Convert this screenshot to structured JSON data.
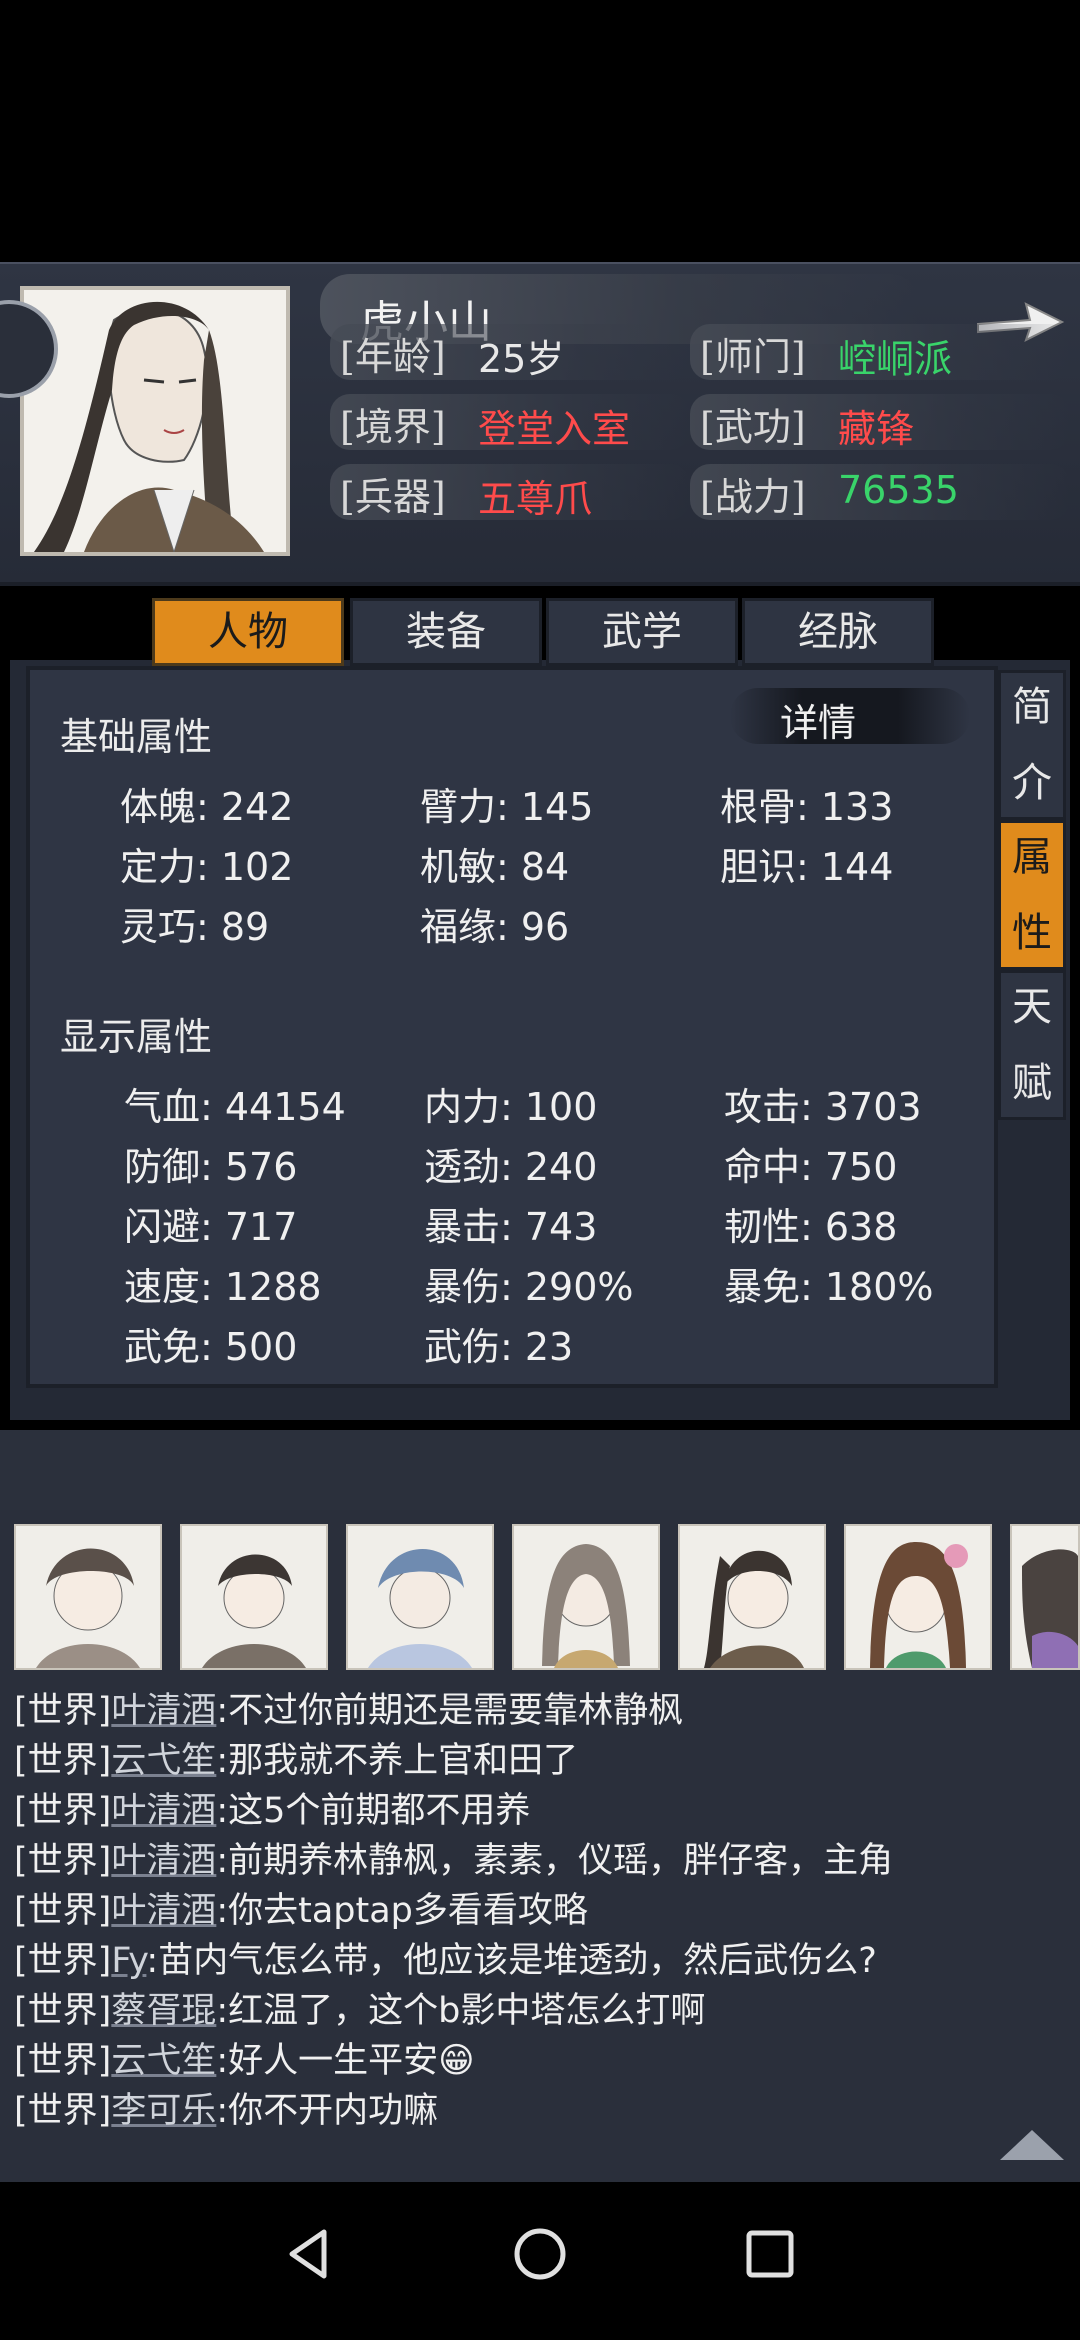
{
  "character": {
    "name": "虎小山",
    "age_label": "[年龄]",
    "age": "25岁",
    "sect_label": "[师门]",
    "sect": "崆峒派",
    "realm_label": "[境界]",
    "realm": "登堂入室",
    "martial_label": "[武功]",
    "martial": "藏锋",
    "weapon_label": "[兵器]",
    "weapon": "五尊爪",
    "power_label": "[战力]",
    "power": "76535"
  },
  "tabs": [
    "人物",
    "装备",
    "武学",
    "经脉"
  ],
  "side_tabs": [
    {
      "c1": "简",
      "c2": "介"
    },
    {
      "c1": "属",
      "c2": "性"
    },
    {
      "c1": "天",
      "c2": "赋"
    }
  ],
  "detail_button": "详情",
  "basic": {
    "title": "基础属性",
    "stats": [
      "体魄: 242",
      "臂力: 145",
      "根骨: 133",
      "定力: 102",
      "机敏: 84",
      "胆识: 144",
      "灵巧: 89",
      "福缘: 96"
    ]
  },
  "display": {
    "title": "显示属性",
    "stats": [
      "气血: 44154",
      "内力: 100",
      "攻击: 3703",
      "防御: 576",
      "透劲: 240",
      "命中: 750",
      "闪避: 717",
      "暴击: 743",
      "韧性: 638",
      "速度: 1288",
      "暴伤: 290%",
      "暴免: 180%",
      "武免: 500",
      "武伤: 23"
    ]
  },
  "chat": [
    {
      "channel": "[世界]",
      "user": "叶清酒",
      "msg": ":不过你前期还是需要靠林静枫"
    },
    {
      "channel": "[世界]",
      "user": "云弋笙",
      "msg": ":那我就不养上官和田了"
    },
    {
      "channel": "[世界]",
      "user": "叶清酒",
      "msg": ":这5个前期都不用养"
    },
    {
      "channel": "[世界]",
      "user": "叶清酒",
      "msg": ":前期养林静枫，素素，仪瑶，胖仔客，主角"
    },
    {
      "channel": "[世界]",
      "user": "叶清酒",
      "msg": ":你去taptap多看看攻略"
    },
    {
      "channel": "[世界]",
      "user": "Fy",
      "msg": ":苗内气怎么带，他应该是堆透劲，然后武伤么?"
    },
    {
      "channel": "[世界]",
      "user": "蔡胥琨",
      "msg": ":红温了，这个b影中塔怎么打啊"
    },
    {
      "channel": "[世界]",
      "user": "云弋笙",
      "msg": ":好人一生平安😁"
    },
    {
      "channel": "[世界]",
      "user": "李可乐",
      "msg": ":你不开内功嘛"
    }
  ],
  "colors": {
    "accent": "#e08b1c",
    "red_value": "#ff4b4b",
    "green_value": "#39d46a",
    "panel": "#2f3544"
  }
}
